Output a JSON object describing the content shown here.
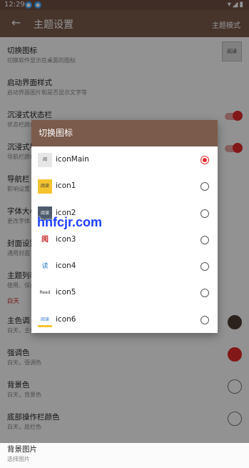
{
  "status_bar": {
    "time": "12:29",
    "icons": "▾◢▮"
  },
  "app_bar": {
    "back_icon": "←",
    "title": "主题设置",
    "action": "主题模式"
  },
  "settings": {
    "items": [
      {
        "title": "切换图标",
        "subtitle": "切换软件显示在桌面的图标"
      },
      {
        "title": "启动界面样式",
        "subtitle": "启动界面图片和是否显示文字等"
      },
      {
        "title": "沉浸式状态栏",
        "subtitle": "状态栏颜色"
      },
      {
        "title": "沉浸式导",
        "subtitle": "导航栏颜色"
      },
      {
        "title": "导航栏",
        "subtitle": "影响设置"
      },
      {
        "title": "字体大小",
        "subtitle": "更改字体"
      },
      {
        "title": "封面设置",
        "subtitle": "通用封面"
      },
      {
        "title": "主题列表",
        "subtitle": "使用、保存"
      }
    ],
    "section_label": "白天",
    "color_items": [
      {
        "title": "主色调",
        "subtitle": "白天，主色调"
      },
      {
        "title": "强调色",
        "subtitle": "白天，强调色"
      },
      {
        "title": "背景色",
        "subtitle": "白天，背景色"
      },
      {
        "title": "底部操作栏颜色",
        "subtitle": "白天，底栏色"
      },
      {
        "title": "背景图片",
        "subtitle": "选择图片"
      }
    ],
    "thumb_text": "阅读"
  },
  "dialog": {
    "title": "切换图标",
    "options": [
      {
        "label": "iconMain",
        "icon": "阅",
        "selected": true
      },
      {
        "label": "icon1",
        "icon": "阅读",
        "selected": false
      },
      {
        "label": "icon2",
        "icon": "阅读",
        "selected": false
      },
      {
        "label": "icon3",
        "icon": "阅",
        "selected": false
      },
      {
        "label": "icon4",
        "icon": "读",
        "selected": false
      },
      {
        "label": "icon5",
        "icon": "Read",
        "selected": false
      },
      {
        "label": "icon6",
        "icon": "阅读",
        "selected": false
      }
    ]
  },
  "watermark": "hnfcjr.com",
  "colors": {
    "primary": "#7b5b4b",
    "accent": "#e02a2a",
    "primary_swatch": "#4a3b33",
    "accent_swatch": "#e02a2a"
  }
}
